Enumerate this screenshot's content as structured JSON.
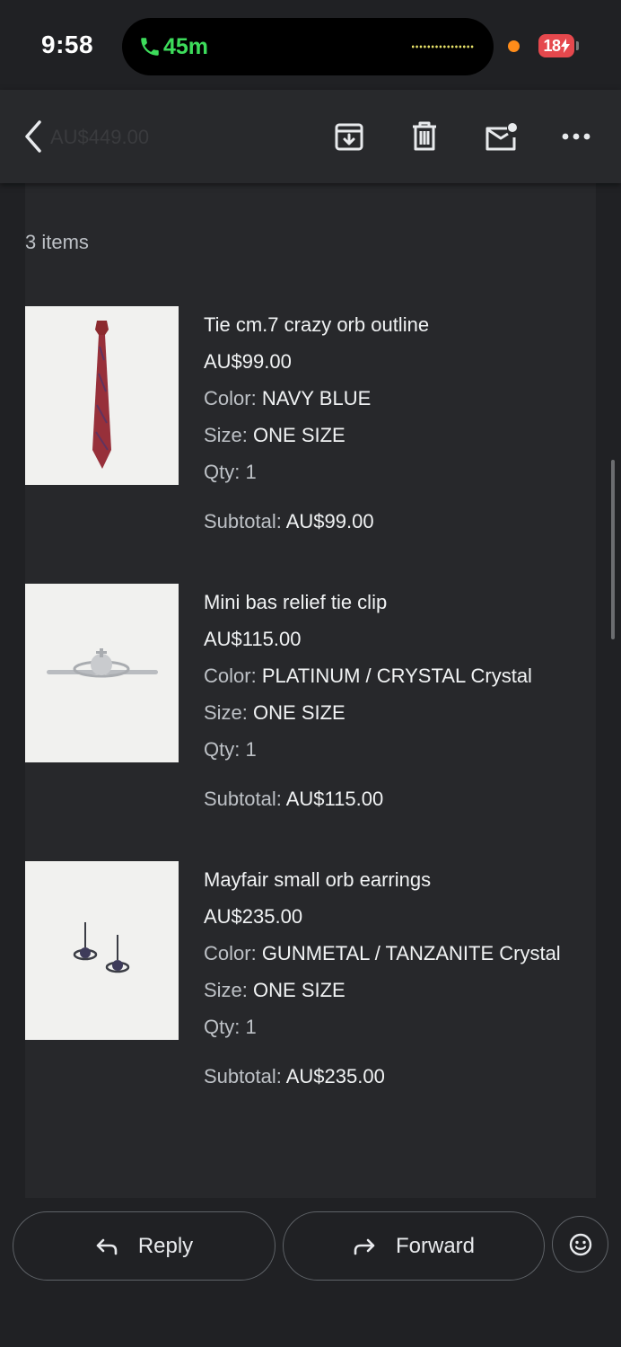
{
  "status_bar": {
    "time": "9:58",
    "call_duration": "45m",
    "battery_level": "18"
  },
  "app_bar": {
    "ghost_amount": "AU$449.00",
    "icons": [
      "back-arrow-icon",
      "archive-icon",
      "delete-icon",
      "mark-unread-icon",
      "more-options-icon"
    ]
  },
  "order": {
    "items_count": "3 items",
    "items": [
      {
        "name": "Tie cm.7 crazy orb outline",
        "price": "AU$99.00",
        "color_label": "Color:",
        "color": "NAVY BLUE",
        "size_label": "Size:",
        "size": "ONE SIZE",
        "qty_label": "Qty:",
        "qty": "1",
        "subtotal_label": "Subtotal:",
        "subtotal": "AU$99.00"
      },
      {
        "name": "Mini bas relief tie clip",
        "price": "AU$115.00",
        "color_label": "Color:",
        "color": "PLATINUM / CRYSTAL Crystal",
        "size_label": "Size:",
        "size": "ONE SIZE",
        "qty_label": "Qty:",
        "qty": "1",
        "subtotal_label": "Subtotal:",
        "subtotal": "AU$115.00"
      },
      {
        "name": "Mayfair small orb earrings",
        "price": "AU$235.00",
        "color_label": "Color:",
        "color": "GUNMETAL / TANZANITE Crystal",
        "size_label": "Size:",
        "size": "ONE SIZE",
        "qty_label": "Qty:",
        "qty": "1",
        "subtotal_label": "Subtotal:",
        "subtotal": "AU$235.00"
      }
    ]
  },
  "actions": {
    "reply": "Reply",
    "forward": "Forward"
  },
  "colors": {
    "background": "#202124",
    "card": "#27282b",
    "call_green": "#3ddc5b",
    "battery_red": "#e5484d"
  }
}
